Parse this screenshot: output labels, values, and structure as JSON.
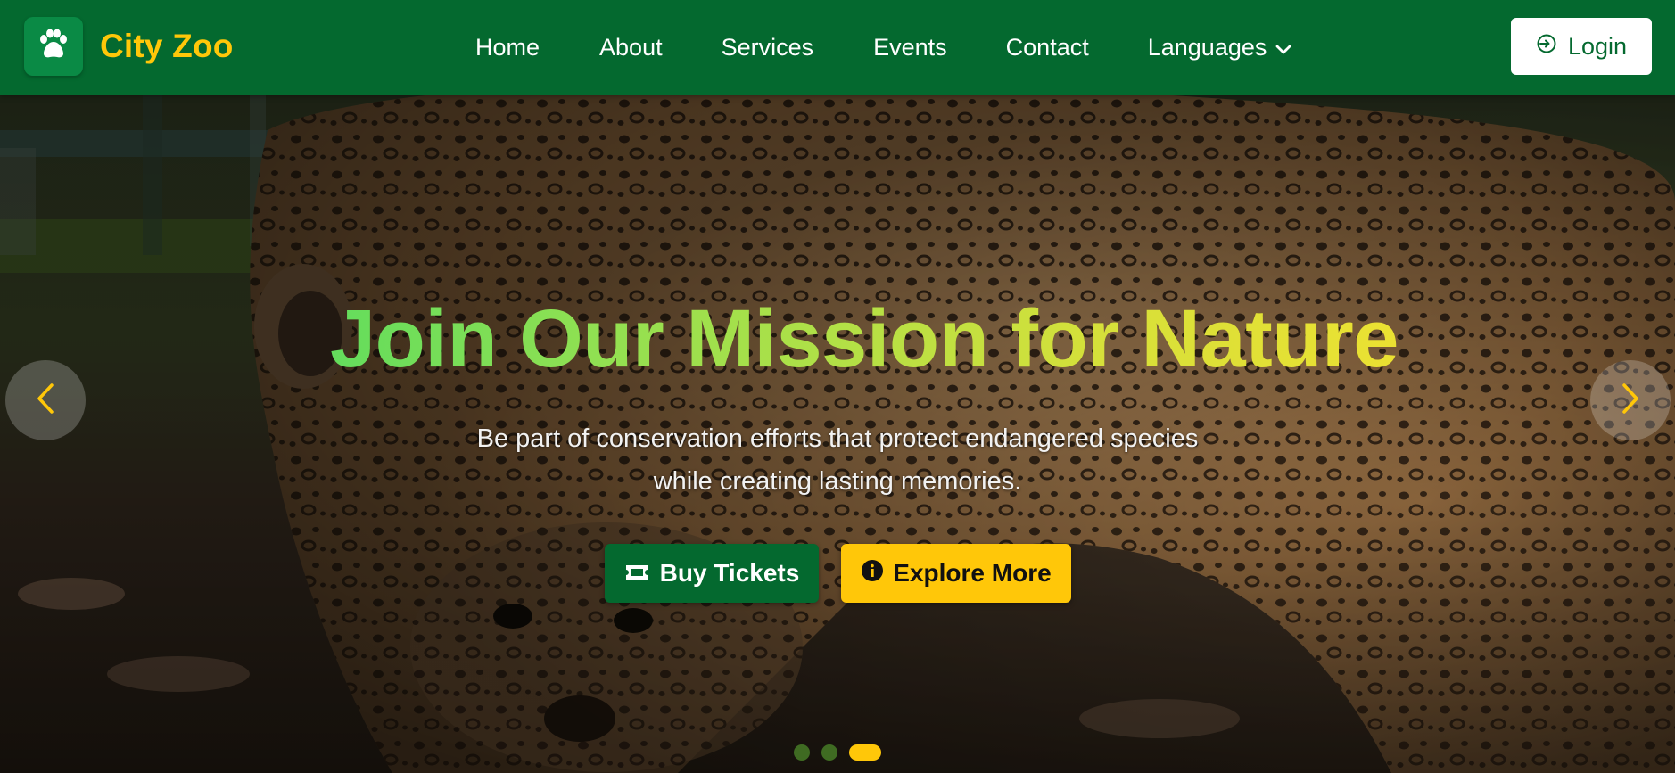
{
  "brand": {
    "name": "City Zoo",
    "icon": "paw-icon"
  },
  "nav": {
    "items": [
      {
        "label": "Home"
      },
      {
        "label": "About"
      },
      {
        "label": "Services"
      },
      {
        "label": "Events"
      },
      {
        "label": "Contact"
      },
      {
        "label": "Languages",
        "icon": "chevron-down-icon"
      }
    ]
  },
  "login": {
    "label": "Login",
    "icon": "sign-in-icon"
  },
  "hero": {
    "title": "Join Our Mission for Nature",
    "subtitle_line1": "Be part of conservation efforts that protect endangered species",
    "subtitle_line2": "while creating lasting memories.",
    "primary_button": {
      "label": "Buy Tickets",
      "icon": "ticket-icon"
    },
    "secondary_button": {
      "label": "Explore More",
      "icon": "info-circle-icon"
    },
    "background": "leopard photo",
    "slides_total": 3,
    "active_slide": 3
  },
  "colors": {
    "nav_bg": "#04692f",
    "brand_yellow": "#ffc709",
    "title_gradient_start": "#2bd86a",
    "title_gradient_end": "#ffe22b"
  }
}
